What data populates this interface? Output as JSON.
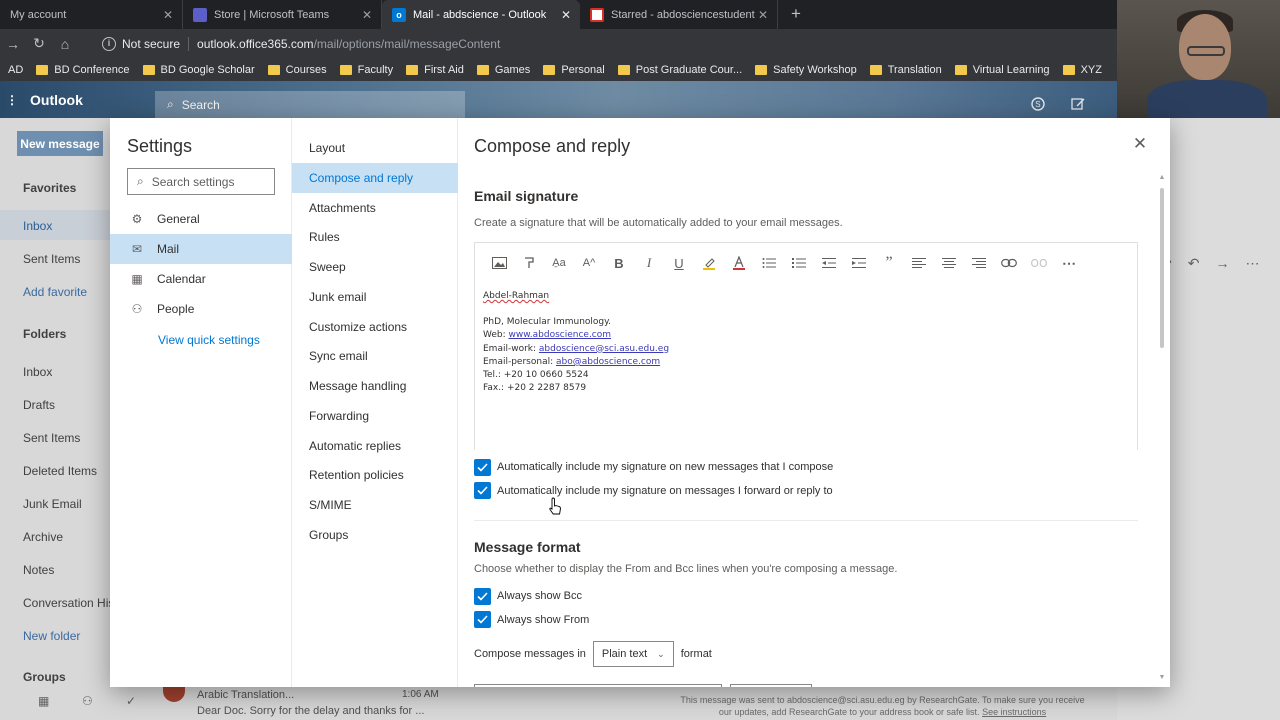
{
  "browser": {
    "tabs": [
      {
        "label": "My account",
        "active": false,
        "icon": "account-icon"
      },
      {
        "label": "Store | Microsoft Teams",
        "active": false,
        "icon": "teams-icon"
      },
      {
        "label": "Mail - abdscience - Outlook",
        "active": true,
        "icon": "outlook-icon"
      },
      {
        "label": "Starred - abdosciencestudents@",
        "active": false,
        "icon": "gmail-icon"
      }
    ],
    "security_label": "Not secure",
    "url_host": "outlook.office365.com",
    "url_path": "/mail/options/mail/messageContent",
    "bookmarks": [
      "AD",
      "BD Conference",
      "BD Google Scholar",
      "Courses",
      "Faculty",
      "First Aid",
      "Games",
      "Personal",
      "Post Graduate Cour...",
      "Safety Workshop",
      "Translation",
      "Virtual Learning",
      "XYZ"
    ]
  },
  "outlook": {
    "brand": "Outlook",
    "search_placeholder": "Search",
    "new_message": "New message",
    "rail": {
      "favorites": "Favorites",
      "fav_items": [
        "Inbox",
        "Sent Items"
      ],
      "add_favorite": "Add favorite",
      "folders": "Folders",
      "folder_items": [
        "Inbox",
        "Drafts",
        "Sent Items",
        "Deleted Items",
        "Junk Email",
        "Archive",
        "Notes",
        "Conversation His"
      ],
      "new_folder": "New folder",
      "groups": "Groups"
    },
    "preview": {
      "from": "Arabic Translation...",
      "time": "1:06 AM",
      "snippet": "Dear Doc. Sorry for the delay and thanks for ..."
    },
    "footnote": "This message was sent to abdoscience@sci.asu.edu.eg by ResearchGate. To make sure you receive our updates, add ResearchGate to your address book or safe list.",
    "footnote_link": "See instructions"
  },
  "settings": {
    "title": "Settings",
    "search_placeholder": "Search settings",
    "categories": [
      {
        "label": "General",
        "icon": "gear-icon",
        "selected": false
      },
      {
        "label": "Mail",
        "icon": "mail-icon",
        "selected": true
      },
      {
        "label": "Calendar",
        "icon": "calendar-icon",
        "selected": false
      },
      {
        "label": "People",
        "icon": "people-icon",
        "selected": false
      }
    ],
    "view_quick": "View quick settings",
    "subcategories": [
      "Layout",
      "Compose and reply",
      "Attachments",
      "Rules",
      "Sweep",
      "Junk email",
      "Customize actions",
      "Sync email",
      "Message handling",
      "Forwarding",
      "Automatic replies",
      "Retention policies",
      "S/MIME",
      "Groups"
    ],
    "selected_subcategory": "Compose and reply"
  },
  "compose": {
    "title": "Compose and reply",
    "signature_heading": "Email signature",
    "signature_desc": "Create a signature that will be automatically added to your email messages.",
    "toolbar_icons": [
      "insert-image-icon",
      "format-painter-icon",
      "font-icon",
      "font-size-icon",
      "bold-icon",
      "italic-icon",
      "underline-icon",
      "highlight-icon",
      "font-color-icon",
      "bullets-icon",
      "numbering-icon",
      "decrease-indent-icon",
      "increase-indent-icon",
      "quote-icon",
      "align-left-icon",
      "align-center-icon",
      "align-right-icon",
      "link-icon",
      "unlink-icon",
      "more-icon"
    ],
    "signature": {
      "name": "Abdel-Rahman",
      "degree": "PhD, Molecular Immunology.",
      "web_label": "Web: ",
      "web": "www.abdoscience.com",
      "work_label": "Email-work: ",
      "work": "abdoscience@sci.asu.edu.eg",
      "personal_label": "Email-personal: ",
      "personal": "abo@abdoscience.com",
      "tel": "Tel.: +20 10 0660 5524",
      "fax": "Fax.: +20 2 2287 8579"
    },
    "auto_new": {
      "label": "Automatically include my signature on new messages that I compose",
      "checked": true
    },
    "auto_reply": {
      "label": "Automatically include my signature on messages I forward or reply to",
      "checked": true
    },
    "format_heading": "Message format",
    "format_desc": "Choose whether to display the From and Bcc lines when you're composing a message.",
    "always_bcc": {
      "label": "Always show Bcc",
      "checked": true
    },
    "always_from": {
      "label": "Always show From",
      "checked": true
    },
    "compose_in_label": "Compose messages in",
    "compose_format": "Plain text",
    "format_suffix": "format"
  },
  "colors": {
    "accent": "#0078d4",
    "selection": "#c7e0f4",
    "chrome_dark": "#202124",
    "chrome_bar": "#35363a"
  }
}
